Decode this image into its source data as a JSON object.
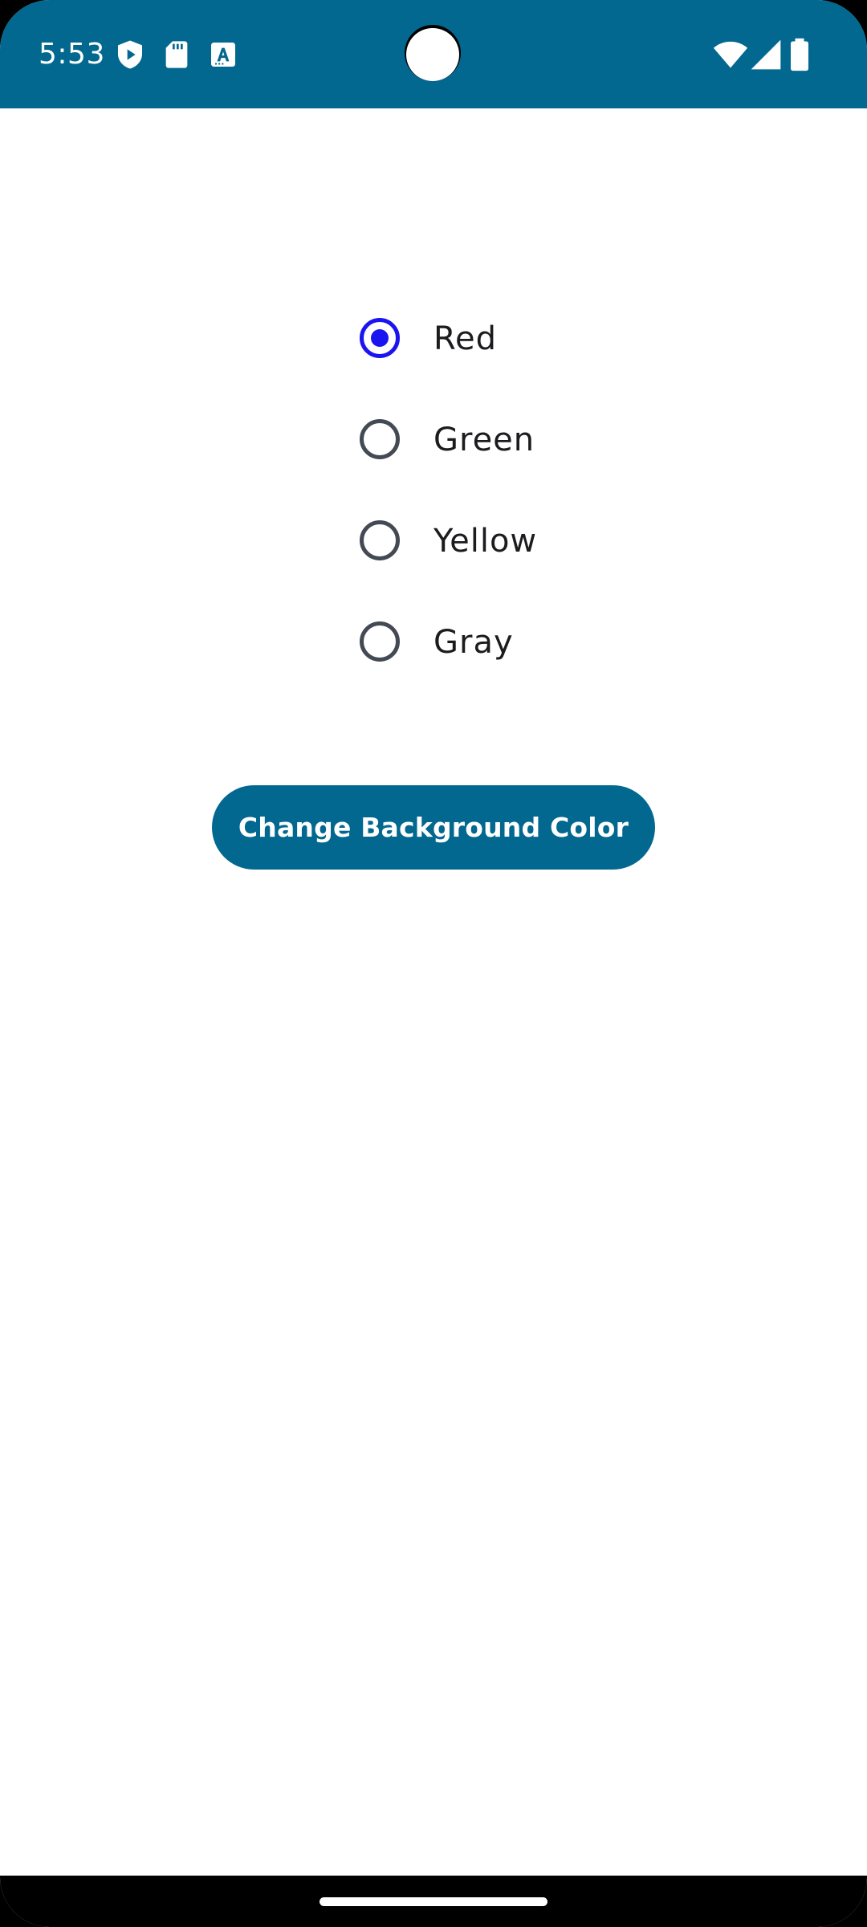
{
  "status_bar": {
    "time": "5:53",
    "background": "#02688f",
    "left_icons": [
      "play-protect-icon",
      "sd-card-icon",
      "font-app-icon"
    ],
    "right_icons": [
      "wifi-icon",
      "cell-signal-icon",
      "battery-icon"
    ]
  },
  "radio_group": {
    "selected": "Red",
    "accent_color": "#1a14f0",
    "options": [
      {
        "label": "Red",
        "checked": true
      },
      {
        "label": "Green",
        "checked": false
      },
      {
        "label": "Yellow",
        "checked": false
      },
      {
        "label": "Gray",
        "checked": false
      }
    ]
  },
  "action_button": {
    "label": "Change Background Color",
    "color": "#02688f"
  }
}
